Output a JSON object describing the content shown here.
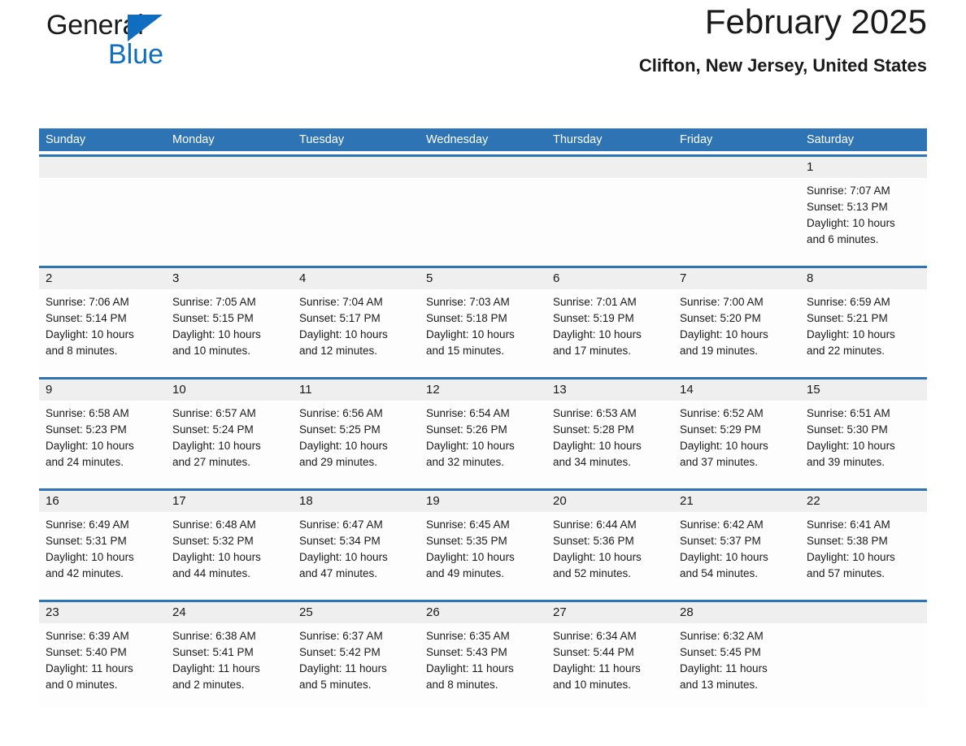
{
  "brand": {
    "name_line1": "General",
    "name_line2": "Blue",
    "triangle_color": "#0f6ec0"
  },
  "header": {
    "title": "February 2025",
    "subtitle": "Clifton, New Jersey, United States"
  },
  "colors": {
    "header_blue": "#2e74b5",
    "date_band_gray": "#efefef",
    "cell_white": "#fdfdfd",
    "text": "#1a1a1a"
  },
  "weekdays": [
    "Sunday",
    "Monday",
    "Tuesday",
    "Wednesday",
    "Thursday",
    "Friday",
    "Saturday"
  ],
  "weeks": [
    {
      "days": [
        {
          "num": "",
          "sunrise": "",
          "sunset": "",
          "daylight_line1": "",
          "daylight_line2": ""
        },
        {
          "num": "",
          "sunrise": "",
          "sunset": "",
          "daylight_line1": "",
          "daylight_line2": ""
        },
        {
          "num": "",
          "sunrise": "",
          "sunset": "",
          "daylight_line1": "",
          "daylight_line2": ""
        },
        {
          "num": "",
          "sunrise": "",
          "sunset": "",
          "daylight_line1": "",
          "daylight_line2": ""
        },
        {
          "num": "",
          "sunrise": "",
          "sunset": "",
          "daylight_line1": "",
          "daylight_line2": ""
        },
        {
          "num": "",
          "sunrise": "",
          "sunset": "",
          "daylight_line1": "",
          "daylight_line2": ""
        },
        {
          "num": "1",
          "sunrise": "Sunrise: 7:07 AM",
          "sunset": "Sunset: 5:13 PM",
          "daylight_line1": "Daylight: 10 hours",
          "daylight_line2": "and 6 minutes."
        }
      ]
    },
    {
      "days": [
        {
          "num": "2",
          "sunrise": "Sunrise: 7:06 AM",
          "sunset": "Sunset: 5:14 PM",
          "daylight_line1": "Daylight: 10 hours",
          "daylight_line2": "and 8 minutes."
        },
        {
          "num": "3",
          "sunrise": "Sunrise: 7:05 AM",
          "sunset": "Sunset: 5:15 PM",
          "daylight_line1": "Daylight: 10 hours",
          "daylight_line2": "and 10 minutes."
        },
        {
          "num": "4",
          "sunrise": "Sunrise: 7:04 AM",
          "sunset": "Sunset: 5:17 PM",
          "daylight_line1": "Daylight: 10 hours",
          "daylight_line2": "and 12 minutes."
        },
        {
          "num": "5",
          "sunrise": "Sunrise: 7:03 AM",
          "sunset": "Sunset: 5:18 PM",
          "daylight_line1": "Daylight: 10 hours",
          "daylight_line2": "and 15 minutes."
        },
        {
          "num": "6",
          "sunrise": "Sunrise: 7:01 AM",
          "sunset": "Sunset: 5:19 PM",
          "daylight_line1": "Daylight: 10 hours",
          "daylight_line2": "and 17 minutes."
        },
        {
          "num": "7",
          "sunrise": "Sunrise: 7:00 AM",
          "sunset": "Sunset: 5:20 PM",
          "daylight_line1": "Daylight: 10 hours",
          "daylight_line2": "and 19 minutes."
        },
        {
          "num": "8",
          "sunrise": "Sunrise: 6:59 AM",
          "sunset": "Sunset: 5:21 PM",
          "daylight_line1": "Daylight: 10 hours",
          "daylight_line2": "and 22 minutes."
        }
      ]
    },
    {
      "days": [
        {
          "num": "9",
          "sunrise": "Sunrise: 6:58 AM",
          "sunset": "Sunset: 5:23 PM",
          "daylight_line1": "Daylight: 10 hours",
          "daylight_line2": "and 24 minutes."
        },
        {
          "num": "10",
          "sunrise": "Sunrise: 6:57 AM",
          "sunset": "Sunset: 5:24 PM",
          "daylight_line1": "Daylight: 10 hours",
          "daylight_line2": "and 27 minutes."
        },
        {
          "num": "11",
          "sunrise": "Sunrise: 6:56 AM",
          "sunset": "Sunset: 5:25 PM",
          "daylight_line1": "Daylight: 10 hours",
          "daylight_line2": "and 29 minutes."
        },
        {
          "num": "12",
          "sunrise": "Sunrise: 6:54 AM",
          "sunset": "Sunset: 5:26 PM",
          "daylight_line1": "Daylight: 10 hours",
          "daylight_line2": "and 32 minutes."
        },
        {
          "num": "13",
          "sunrise": "Sunrise: 6:53 AM",
          "sunset": "Sunset: 5:28 PM",
          "daylight_line1": "Daylight: 10 hours",
          "daylight_line2": "and 34 minutes."
        },
        {
          "num": "14",
          "sunrise": "Sunrise: 6:52 AM",
          "sunset": "Sunset: 5:29 PM",
          "daylight_line1": "Daylight: 10 hours",
          "daylight_line2": "and 37 minutes."
        },
        {
          "num": "15",
          "sunrise": "Sunrise: 6:51 AM",
          "sunset": "Sunset: 5:30 PM",
          "daylight_line1": "Daylight: 10 hours",
          "daylight_line2": "and 39 minutes."
        }
      ]
    },
    {
      "days": [
        {
          "num": "16",
          "sunrise": "Sunrise: 6:49 AM",
          "sunset": "Sunset: 5:31 PM",
          "daylight_line1": "Daylight: 10 hours",
          "daylight_line2": "and 42 minutes."
        },
        {
          "num": "17",
          "sunrise": "Sunrise: 6:48 AM",
          "sunset": "Sunset: 5:32 PM",
          "daylight_line1": "Daylight: 10 hours",
          "daylight_line2": "and 44 minutes."
        },
        {
          "num": "18",
          "sunrise": "Sunrise: 6:47 AM",
          "sunset": "Sunset: 5:34 PM",
          "daylight_line1": "Daylight: 10 hours",
          "daylight_line2": "and 47 minutes."
        },
        {
          "num": "19",
          "sunrise": "Sunrise: 6:45 AM",
          "sunset": "Sunset: 5:35 PM",
          "daylight_line1": "Daylight: 10 hours",
          "daylight_line2": "and 49 minutes."
        },
        {
          "num": "20",
          "sunrise": "Sunrise: 6:44 AM",
          "sunset": "Sunset: 5:36 PM",
          "daylight_line1": "Daylight: 10 hours",
          "daylight_line2": "and 52 minutes."
        },
        {
          "num": "21",
          "sunrise": "Sunrise: 6:42 AM",
          "sunset": "Sunset: 5:37 PM",
          "daylight_line1": "Daylight: 10 hours",
          "daylight_line2": "and 54 minutes."
        },
        {
          "num": "22",
          "sunrise": "Sunrise: 6:41 AM",
          "sunset": "Sunset: 5:38 PM",
          "daylight_line1": "Daylight: 10 hours",
          "daylight_line2": "and 57 minutes."
        }
      ]
    },
    {
      "days": [
        {
          "num": "23",
          "sunrise": "Sunrise: 6:39 AM",
          "sunset": "Sunset: 5:40 PM",
          "daylight_line1": "Daylight: 11 hours",
          "daylight_line2": "and 0 minutes."
        },
        {
          "num": "24",
          "sunrise": "Sunrise: 6:38 AM",
          "sunset": "Sunset: 5:41 PM",
          "daylight_line1": "Daylight: 11 hours",
          "daylight_line2": "and 2 minutes."
        },
        {
          "num": "25",
          "sunrise": "Sunrise: 6:37 AM",
          "sunset": "Sunset: 5:42 PM",
          "daylight_line1": "Daylight: 11 hours",
          "daylight_line2": "and 5 minutes."
        },
        {
          "num": "26",
          "sunrise": "Sunrise: 6:35 AM",
          "sunset": "Sunset: 5:43 PM",
          "daylight_line1": "Daylight: 11 hours",
          "daylight_line2": "and 8 minutes."
        },
        {
          "num": "27",
          "sunrise": "Sunrise: 6:34 AM",
          "sunset": "Sunset: 5:44 PM",
          "daylight_line1": "Daylight: 11 hours",
          "daylight_line2": "and 10 minutes."
        },
        {
          "num": "28",
          "sunrise": "Sunrise: 6:32 AM",
          "sunset": "Sunset: 5:45 PM",
          "daylight_line1": "Daylight: 11 hours",
          "daylight_line2": "and 13 minutes."
        },
        {
          "num": "",
          "sunrise": "",
          "sunset": "",
          "daylight_line1": "",
          "daylight_line2": ""
        }
      ]
    }
  ]
}
